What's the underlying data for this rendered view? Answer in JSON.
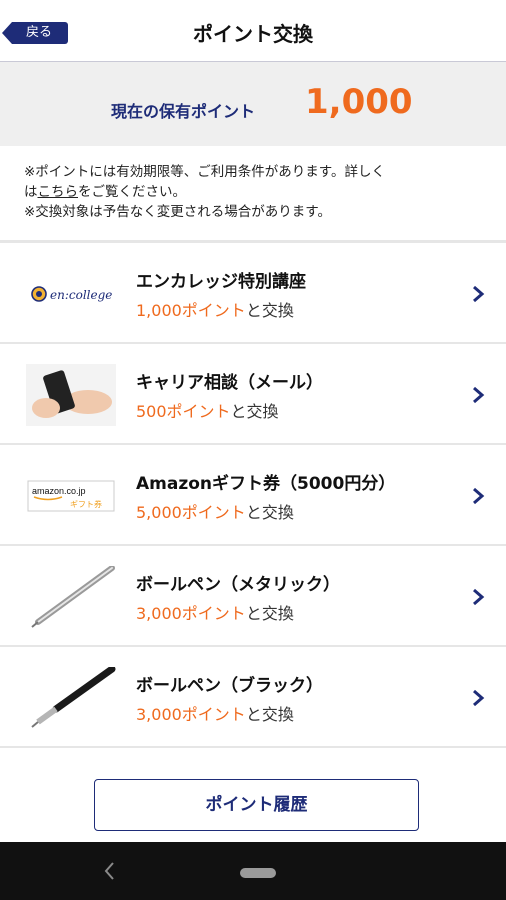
{
  "header": {
    "back_label": "戻る",
    "title": "ポイント交換"
  },
  "points": {
    "label": "現在の保有ポイント",
    "value": "1,000"
  },
  "notes": {
    "line1": "※ポイントには有効期限等、ご利用条件があります。詳しく",
    "line2_prefix": "は",
    "line2_link": "こちら",
    "line2_suffix": "をご覧ください。",
    "line3": "※交換対象は予告なく変更される場合があります。"
  },
  "items": [
    {
      "title": "エンカレッジ特別講座",
      "points": "1,000ポイント",
      "suffix": "と交換",
      "thumb_text": "en:college"
    },
    {
      "title": "キャリア相談（メール）",
      "points": "500ポイント",
      "suffix": "と交換"
    },
    {
      "title": "Amazonギフト券（5000円分）",
      "points": "5,000ポイント",
      "suffix": "と交換",
      "thumb_text_1": "amazon.co.jp",
      "thumb_text_2": "ギフト券"
    },
    {
      "title": "ボールペン（メタリック）",
      "points": "3,000ポイント",
      "suffix": "と交換"
    },
    {
      "title": "ボールペン（ブラック）",
      "points": "3,000ポイント",
      "suffix": "と交換"
    }
  ],
  "history_button": "ポイント履歴",
  "colors": {
    "brand_navy": "#1e2c78",
    "accent_orange": "#ef6a1e"
  },
  "icons": [
    "back-arrow-icon",
    "chevron-right-icon",
    "nav-back-icon",
    "nav-home-pill-icon"
  ]
}
